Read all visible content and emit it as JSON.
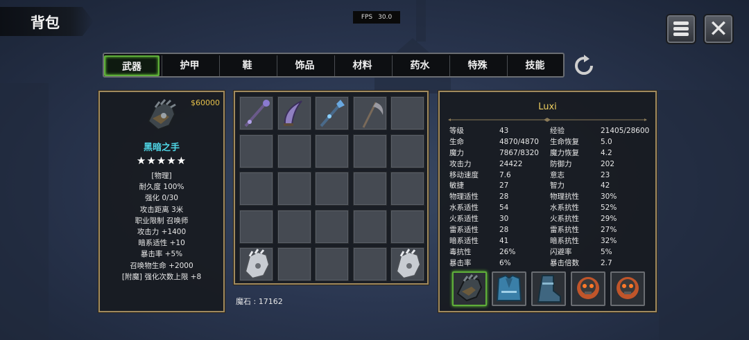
{
  "header": {
    "title": "背包"
  },
  "fps": {
    "label": "FPS",
    "value": "30.0"
  },
  "top_buttons": {
    "menu_icon": "hamburger-menu-icon",
    "close_icon": "close-x-icon"
  },
  "tabs": [
    {
      "label": "武器",
      "active": true
    },
    {
      "label": "护甲",
      "active": false
    },
    {
      "label": "鞋",
      "active": false
    },
    {
      "label": "饰品",
      "active": false
    },
    {
      "label": "材料",
      "active": false
    },
    {
      "label": "药水",
      "active": false
    },
    {
      "label": "特殊",
      "active": false
    },
    {
      "label": "技能",
      "active": false
    }
  ],
  "refresh_icon": "refresh-icon",
  "item_detail": {
    "icon": "dark-gauntlet-icon",
    "price": "$60000",
    "name": "黑暗之手",
    "stars": "★★★★★",
    "stats": [
      "[物理]",
      "耐久度 100%",
      "强化 0/30",
      "攻击距离  3米",
      "职业限制  召唤师",
      "攻击力  +1400",
      "暗系适性  +10",
      "暴击率  +5%",
      "召唤物生命  +2000",
      "[附魔] 强化次数上限 +8"
    ]
  },
  "inventory": {
    "slots": [
      "purple-staff-icon",
      "curved-blade-icon",
      "crystal-spear-icon",
      "scythe-icon",
      "",
      "",
      "",
      "",
      "",
      "",
      "",
      "",
      "",
      "",
      "",
      "",
      "",
      "",
      "",
      "",
      "gauntlet-icon",
      "",
      "",
      "",
      "gauntlet-icon"
    ],
    "mana_stone_label": "魔石 : 17162"
  },
  "character": {
    "name": "Luxi",
    "stats": [
      [
        "等级",
        "43",
        "经验",
        "21405/28600"
      ],
      [
        "生命",
        "4870/4870",
        "生命恢复",
        "5.0"
      ],
      [
        "魔力",
        "7867/8320",
        "魔力恢复",
        "4.2"
      ],
      [
        "攻击力",
        "24422",
        "防御力",
        "202"
      ],
      [
        "移动速度",
        "7.6",
        "意志",
        "23"
      ],
      [
        "敏捷",
        "27",
        "智力",
        "42"
      ],
      [
        "物理适性",
        "28",
        "物理抗性",
        "30%"
      ],
      [
        "水系适性",
        "54",
        "水系抗性",
        "52%"
      ],
      [
        "火系适性",
        "30",
        "火系抗性",
        "29%"
      ],
      [
        "雷系适性",
        "28",
        "雷系抗性",
        "27%"
      ],
      [
        "暗系适性",
        "41",
        "暗系抗性",
        "32%"
      ],
      [
        "毒抗性",
        "26%",
        "闪避率",
        "5%"
      ],
      [
        "暴击率",
        "6%",
        "暴击倍数",
        "2.7"
      ]
    ],
    "equipment": [
      "dark-gauntlet-icon",
      "blue-armor-icon",
      "blue-boot-icon",
      "skull-amulet-icon",
      "skull-amulet-icon"
    ]
  }
}
